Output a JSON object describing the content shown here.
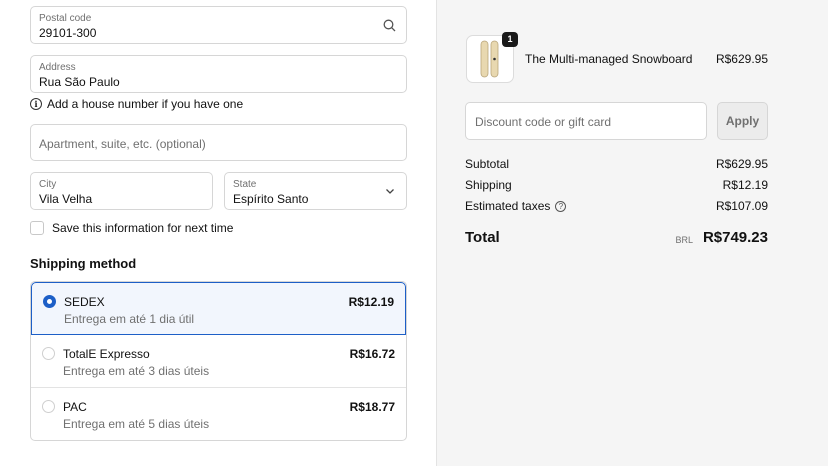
{
  "delivery": {
    "postal_code": {
      "label": "Postal code",
      "value": "29101-300"
    },
    "address": {
      "label": "Address",
      "value": "Rua São Paulo"
    },
    "address_hint": "Add a house number if you have one",
    "apartment": {
      "placeholder": "Apartment, suite, etc. (optional)"
    },
    "city": {
      "label": "City",
      "value": "Vila Velha"
    },
    "state": {
      "label": "State",
      "value": "Espírito Santo"
    },
    "save_info_label": "Save this information for next time"
  },
  "shipping": {
    "title": "Shipping method",
    "options": [
      {
        "name": "SEDEX",
        "sub": "Entrega em até 1 dia útil",
        "price": "R$12.19",
        "selected": true
      },
      {
        "name": "TotalE Expresso",
        "sub": "Entrega em até 3 dias úteis",
        "price": "R$16.72",
        "selected": false
      },
      {
        "name": "PAC",
        "sub": "Entrega em até 5 dias úteis",
        "price": "R$18.77",
        "selected": false
      }
    ]
  },
  "summary": {
    "product": {
      "name": "The Multi-managed Snowboard",
      "price": "R$629.95",
      "quantity": "1"
    },
    "discount_placeholder": "Discount code or gift card",
    "apply_label": "Apply",
    "subtotal_label": "Subtotal",
    "subtotal_value": "R$629.95",
    "shipping_label": "Shipping",
    "shipping_value": "R$12.19",
    "taxes_label": "Estimated taxes",
    "taxes_value": "R$107.09",
    "total_label": "Total",
    "currency": "BRL",
    "total_value": "R$749.23"
  },
  "colors": {
    "accent": "#1d5fc7",
    "panel_bg": "#f5f5f5"
  }
}
